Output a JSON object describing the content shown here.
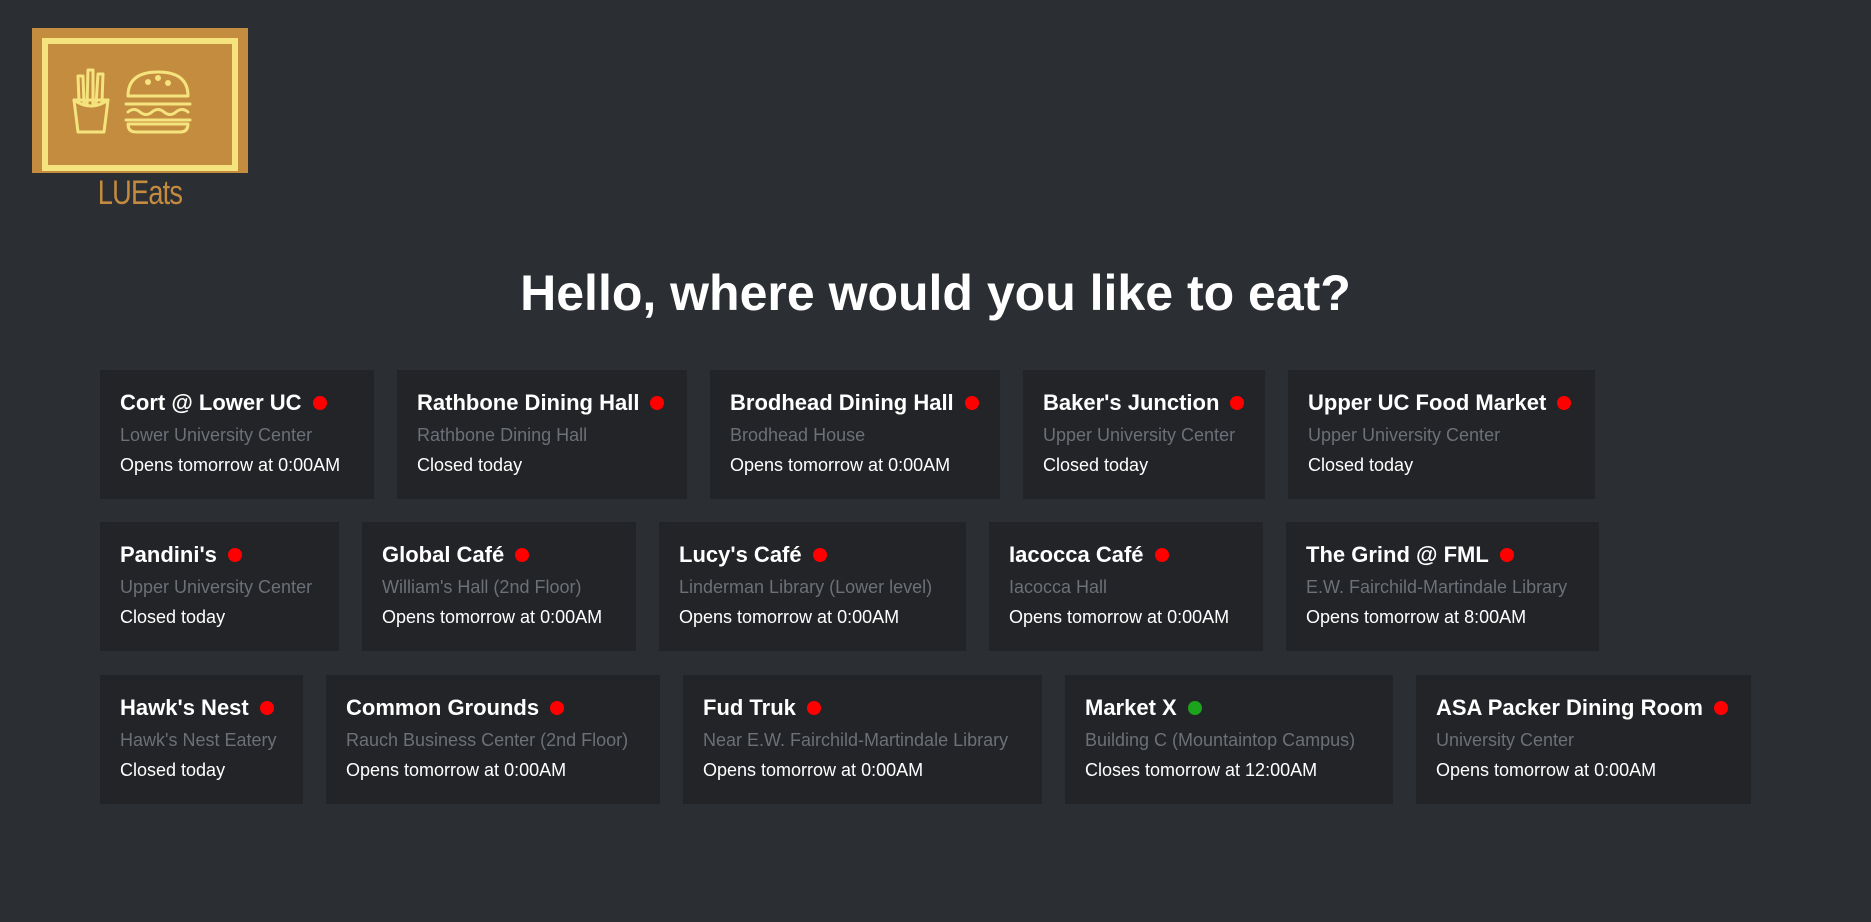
{
  "logo": {
    "text": "LUEats",
    "icons": [
      "fries-icon",
      "burger-icon"
    ]
  },
  "heading": "Hello, where would you like to eat?",
  "colors": {
    "background": "#2b2e33",
    "card": "#222427",
    "open": "#1ca51c",
    "closed": "#ff0000",
    "logo_box": "#c48c3e",
    "logo_frame": "#f5e47d",
    "subtext": "#6c7077"
  },
  "rows": [
    [
      {
        "name": "Cort @ Lower UC",
        "location": "Lower University Center",
        "hours": "Opens tomorrow at 0:00AM",
        "status": "closed"
      },
      {
        "name": "Rathbone Dining Hall",
        "location": "Rathbone Dining Hall",
        "hours": "Closed today",
        "status": "closed"
      },
      {
        "name": "Brodhead Dining Hall",
        "location": "Brodhead House",
        "hours": "Opens tomorrow at 0:00AM",
        "status": "closed"
      },
      {
        "name": "Baker's Junction",
        "location": "Upper University Center",
        "hours": "Closed today",
        "status": "closed"
      },
      {
        "name": "Upper UC Food Market",
        "location": "Upper University Center",
        "hours": "Closed today",
        "status": "closed"
      }
    ],
    [
      {
        "name": "Pandini's",
        "location": "Upper University Center",
        "hours": "Closed today",
        "status": "closed"
      },
      {
        "name": "Global Café",
        "location": "William's Hall (2nd Floor)",
        "hours": "Opens tomorrow at 0:00AM",
        "status": "closed"
      },
      {
        "name": "Lucy's Café",
        "location": "Linderman Library (Lower level)",
        "hours": "Opens tomorrow at 0:00AM",
        "status": "closed"
      },
      {
        "name": "Iacocca Café",
        "location": "Iacocca Hall",
        "hours": "Opens tomorrow at 0:00AM",
        "status": "closed"
      },
      {
        "name": "The Grind @ FML",
        "location": "E.W. Fairchild-Martindale Library",
        "hours": "Opens tomorrow at 8:00AM",
        "status": "closed"
      }
    ],
    [
      {
        "name": "Hawk's Nest",
        "location": "Hawk's Nest Eatery",
        "hours": "Closed today",
        "status": "closed"
      },
      {
        "name": "Common Grounds",
        "location": "Rauch Business Center (2nd Floor)",
        "hours": "Opens tomorrow at 0:00AM",
        "status": "closed"
      },
      {
        "name": "Fud Truk",
        "location": "Near E.W. Fairchild-Martindale Library",
        "hours": "Opens tomorrow at 0:00AM",
        "status": "closed"
      },
      {
        "name": "Market X",
        "location": "Building C (Mountaintop Campus)",
        "hours": "Closes tomorrow at 12:00AM",
        "status": "open"
      },
      {
        "name": "ASA Packer Dining Room",
        "location": "University Center",
        "hours": "Opens tomorrow at 0:00AM",
        "status": "closed"
      }
    ]
  ]
}
